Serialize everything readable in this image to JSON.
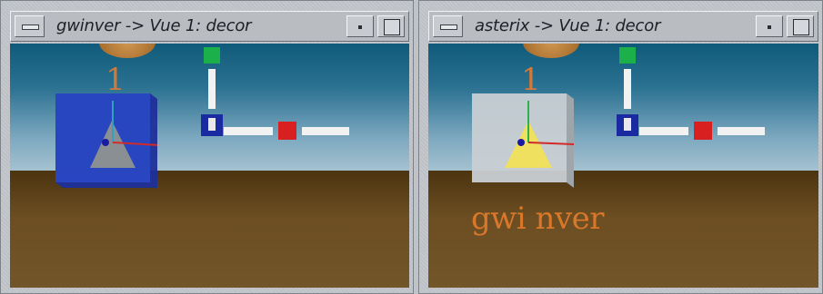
{
  "windows": [
    {
      "title": "gwinver -> Vue 1: decor",
      "cube_color": "#2a48c4",
      "triangle_color": "#8a8f93",
      "label": "1",
      "text_label": ""
    },
    {
      "title": "asterix -> Vue 1: decor",
      "cube_color": "#c8cfd3",
      "triangle_color": "#f0e060",
      "label": "1",
      "text_label": "gwi nver"
    }
  ],
  "colors": {
    "sky_top": "#0f5a7a",
    "ground": "#5e4218",
    "gizmo_green": "#1bb04a",
    "gizmo_blue": "#1a2aa0",
    "gizmo_red": "#d82020",
    "label_orange": "#cf7a3a"
  },
  "icons": {
    "window_menu": "window-menu-icon",
    "minimize": "minimize-icon",
    "maximize": "maximize-icon"
  }
}
